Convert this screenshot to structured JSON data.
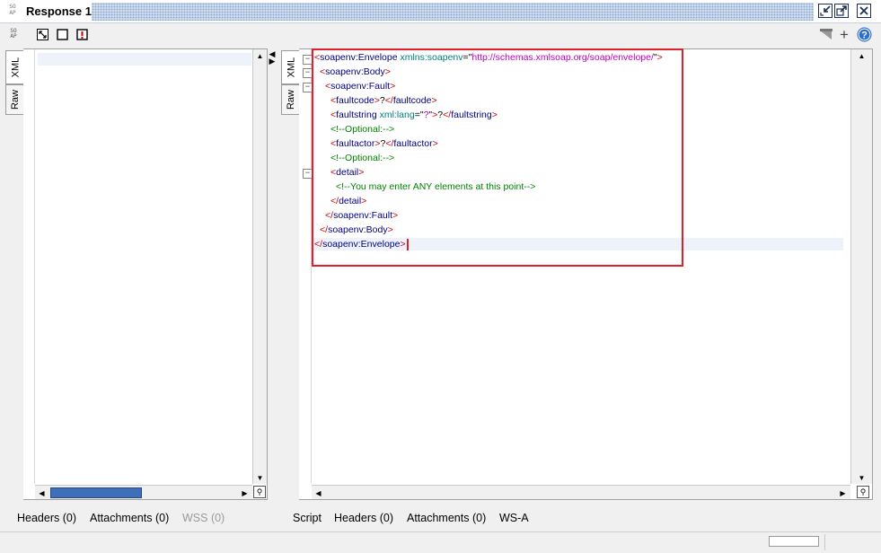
{
  "window": {
    "title": "Response 1",
    "icon_text": "SO\nAP"
  },
  "toolbar": {
    "soap_icon_text": "SO\nAP"
  },
  "left_panel": {
    "tabs": [
      "XML",
      "Raw"
    ],
    "bottom_tabs": [
      "Headers (0)",
      "Attachments (0)",
      "WSS (0)"
    ]
  },
  "right_panel": {
    "tabs": [
      "XML",
      "Raw"
    ],
    "bottom_tabs": [
      "Script",
      "Headers (0)",
      "Attachments (0)",
      "WS-A"
    ],
    "xml_lines": [
      {
        "indent": 0,
        "parts": [
          [
            "br",
            "<"
          ],
          [
            "tag",
            "soapenv:Envelope "
          ],
          [
            "attr",
            "xmlns:soapenv"
          ],
          [
            "txt",
            "=\""
          ],
          [
            "val",
            "http://schemas.xmlsoap.org/soap/envelope/"
          ],
          [
            "txt",
            "\""
          ],
          [
            "br",
            ">"
          ]
        ]
      },
      {
        "indent": 1,
        "parts": [
          [
            "br",
            "<"
          ],
          [
            "tag",
            "soapenv:Body"
          ],
          [
            "br",
            ">"
          ]
        ]
      },
      {
        "indent": 2,
        "parts": [
          [
            "br",
            "<"
          ],
          [
            "tag",
            "soapenv:Fault"
          ],
          [
            "br",
            ">"
          ]
        ]
      },
      {
        "indent": 3,
        "parts": [
          [
            "br",
            "<"
          ],
          [
            "tag",
            "faultcode"
          ],
          [
            "br",
            ">"
          ],
          [
            "txt",
            "?"
          ],
          [
            "br",
            "</"
          ],
          [
            "tag",
            "faultcode"
          ],
          [
            "br",
            ">"
          ]
        ]
      },
      {
        "indent": 3,
        "parts": [
          [
            "br",
            "<"
          ],
          [
            "tag",
            "faultstring "
          ],
          [
            "attr",
            "xml:lang"
          ],
          [
            "txt",
            "=\""
          ],
          [
            "val",
            "?"
          ],
          [
            "txt",
            "\""
          ],
          [
            "br",
            ">"
          ],
          [
            "txt",
            "?"
          ],
          [
            "br",
            "</"
          ],
          [
            "tag",
            "faultstring"
          ],
          [
            "br",
            ">"
          ]
        ]
      },
      {
        "indent": 3,
        "parts": [
          [
            "com",
            "<!--Optional:-->"
          ]
        ]
      },
      {
        "indent": 3,
        "parts": [
          [
            "br",
            "<"
          ],
          [
            "tag",
            "faultactor"
          ],
          [
            "br",
            ">"
          ],
          [
            "txt",
            "?"
          ],
          [
            "br",
            "</"
          ],
          [
            "tag",
            "faultactor"
          ],
          [
            "br",
            ">"
          ]
        ]
      },
      {
        "indent": 3,
        "parts": [
          [
            "com",
            "<!--Optional:-->"
          ]
        ]
      },
      {
        "indent": 3,
        "parts": [
          [
            "br",
            "<"
          ],
          [
            "tag",
            "detail"
          ],
          [
            "br",
            ">"
          ]
        ]
      },
      {
        "indent": 4,
        "parts": [
          [
            "com",
            "<!--You may enter ANY elements at this point-->"
          ]
        ]
      },
      {
        "indent": 3,
        "parts": [
          [
            "br",
            "</"
          ],
          [
            "tag",
            "detail"
          ],
          [
            "br",
            ">"
          ]
        ]
      },
      {
        "indent": 2,
        "parts": [
          [
            "br",
            "</"
          ],
          [
            "tag",
            "soapenv:Fault"
          ],
          [
            "br",
            ">"
          ]
        ]
      },
      {
        "indent": 1,
        "parts": [
          [
            "br",
            "</"
          ],
          [
            "tag",
            "soapenv:Body"
          ],
          [
            "br",
            ">"
          ]
        ]
      },
      {
        "indent": 0,
        "parts": [
          [
            "br",
            "</"
          ],
          [
            "tag",
            "soapenv:Envelope"
          ],
          [
            "br",
            ">"
          ]
        ]
      }
    ]
  },
  "colors": {
    "highlight_border": "#e0202a",
    "scroll_thumb": "#3f6fb8",
    "help_icon": "#2a6fd1"
  }
}
